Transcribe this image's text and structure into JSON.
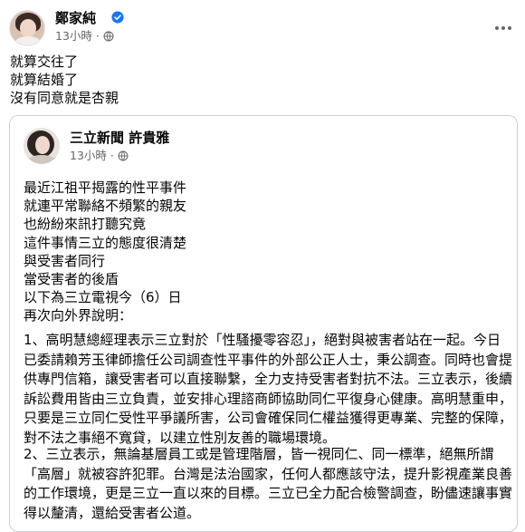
{
  "post": {
    "author": "鄭家純",
    "time": "13小時",
    "separator": "·",
    "lines": [
      "就算交往了",
      "就算結婚了",
      "沒有同意就是杏親"
    ]
  },
  "shared": {
    "author": "三立新聞 許貴雅",
    "time": "13小時",
    "separator": "·",
    "lines": [
      "最近江祖平揭露的性平事件",
      "就連平常聯絡不頻繁的親友",
      "也紛紛來訊打聽究竟",
      "這件事情三立的態度很清楚",
      "與受害者同行",
      "當受害者的後盾",
      "以下為三立電視今（6）日",
      "再次向外界說明："
    ],
    "paragraph1": [
      "1、高明慧總經理表示三立對於「性騷擾零容忍」，絕對與被害者站在一起。今日",
      "已委請賴芳玉律師擔任公司調查性平事件的外部公正人士，秉公調查。同時也會提",
      "供專門信箱，讓受害者可以直接聯繫，全力支持受害者對抗不法。三立表示，後續",
      "訴訟費用皆由三立負責，並安排心理諮商師協助同仁平復身心健康。高明慧重申，",
      "只要是三立同仁受性平爭議所害，公司會確保同仁權益獲得更專業、完整的保障，",
      "對不法之事絕不寬貸，以建立性別友善的職場環境。"
    ],
    "paragraph2": [
      "2、三立表示，無論基層員工或是管理階層，皆一視同仁、同一標準，絕無所謂",
      "「高層」就被容許犯罪。台灣是法治國家，任何人都應該守法，提升影視產業良善",
      "的工作環境，更是三立一直以來的目標。三立已全力配合檢警調查，盼儘速讓事實",
      "得以釐清，還給受害者公道。"
    ]
  },
  "icons": {
    "verified": "verified-badge-icon",
    "audience": "globe-icon",
    "more": "more-options-icon"
  },
  "colors": {
    "verified": "#1877f2",
    "secondary_text": "#65676b",
    "border": "#ced0d4"
  }
}
